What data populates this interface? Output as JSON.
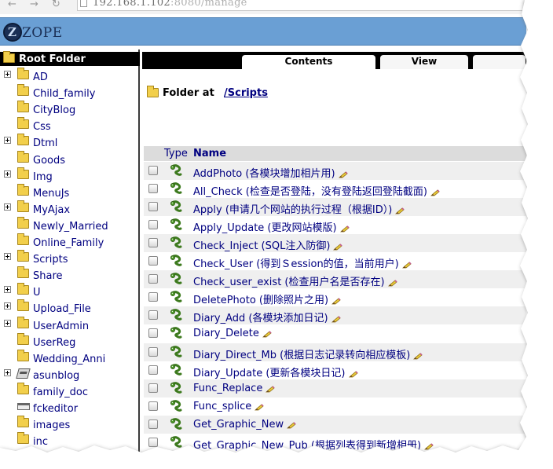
{
  "browser": {
    "back_icon": "arrow-left-icon",
    "forward_icon": "arrow-right-icon",
    "reload_icon": "reload-icon",
    "url_host": "192.168.1.102",
    "url_port": ":8080",
    "url_path": "/manage"
  },
  "header": {
    "logo_text": "ZOPE"
  },
  "tree": {
    "root_label": "Root Folder",
    "items": [
      {
        "label": "AD",
        "expandable": true,
        "icon": "folder-icon"
      },
      {
        "label": "Child_family",
        "expandable": false,
        "icon": "folder-icon"
      },
      {
        "label": "CityBlog",
        "expandable": false,
        "icon": "folder-icon"
      },
      {
        "label": "Css",
        "expandable": false,
        "icon": "folder-icon"
      },
      {
        "label": "Dtml",
        "expandable": true,
        "icon": "folder-icon"
      },
      {
        "label": "Goods",
        "expandable": false,
        "icon": "folder-icon"
      },
      {
        "label": "Img",
        "expandable": true,
        "icon": "folder-icon"
      },
      {
        "label": "MenuJs",
        "expandable": false,
        "icon": "folder-icon"
      },
      {
        "label": "MyAjax",
        "expandable": true,
        "icon": "folder-icon"
      },
      {
        "label": "Newly_Married",
        "expandable": false,
        "icon": "folder-icon"
      },
      {
        "label": "Online_Family",
        "expandable": false,
        "icon": "folder-icon"
      },
      {
        "label": "Scripts",
        "expandable": true,
        "icon": "folder-icon"
      },
      {
        "label": "Share",
        "expandable": false,
        "icon": "folder-icon"
      },
      {
        "label": "U",
        "expandable": true,
        "icon": "folder-icon"
      },
      {
        "label": "Upload_File",
        "expandable": true,
        "icon": "folder-icon"
      },
      {
        "label": "UserAdmin",
        "expandable": true,
        "icon": "folder-icon"
      },
      {
        "label": "UserReg",
        "expandable": false,
        "icon": "folder-icon"
      },
      {
        "label": "Wedding_Anni",
        "expandable": false,
        "icon": "folder-icon"
      },
      {
        "label": "asunblog",
        "expandable": true,
        "icon": "disk-icon"
      },
      {
        "label": "family_doc",
        "expandable": false,
        "icon": "folder-icon"
      },
      {
        "label": "fckeditor",
        "expandable": false,
        "icon": "fckeditor-icon"
      },
      {
        "label": "images",
        "expandable": false,
        "icon": "folder-icon"
      },
      {
        "label": "inc",
        "expandable": false,
        "icon": "folder-icon"
      }
    ]
  },
  "tabs": [
    {
      "label": "Contents",
      "active": true
    },
    {
      "label": "View",
      "active": false
    },
    {
      "label": "",
      "active": false
    }
  ],
  "location": {
    "label": "Folder at",
    "path": "/Scripts"
  },
  "list": {
    "header_type": "Type",
    "header_name": "Name",
    "rows": [
      {
        "name": "AddPhoto",
        "desc": " (各模块增加相片用)"
      },
      {
        "name": "All_Check",
        "desc": " (检查是否登陆，没有登陆返回登陆截面)"
      },
      {
        "name": "Apply",
        "desc": " (申请几个网站的执行过程（根据ID）)"
      },
      {
        "name": "Apply_Update",
        "desc": " (更改网站模版)"
      },
      {
        "name": "Check_Inject",
        "desc": " (SQL注入防御)"
      },
      {
        "name": "Check_User",
        "desc": " (得到Ｓession的值，当前用户)"
      },
      {
        "name": "Check_user_exist",
        "desc": " (检查用户名是否存在)"
      },
      {
        "name": "DeletePhoto",
        "desc": " (删除照片之用)"
      },
      {
        "name": "Diary_Add",
        "desc": " (各模块添加日记)"
      },
      {
        "name": "Diary_Delete",
        "desc": ""
      },
      {
        "name": "Diary_Direct_Mb",
        "desc": " (根据日志记录转向相应模板)"
      },
      {
        "name": "Diary_Update",
        "desc": " (更新各模块日记)"
      },
      {
        "name": "Func_Replace",
        "desc": ""
      },
      {
        "name": "Func_splice",
        "desc": ""
      },
      {
        "name": "Get_Graphic_New",
        "desc": ""
      },
      {
        "name": "Get_Graphic_New_Pub",
        "desc": " (根据列表得到新增相册)"
      }
    ]
  }
}
